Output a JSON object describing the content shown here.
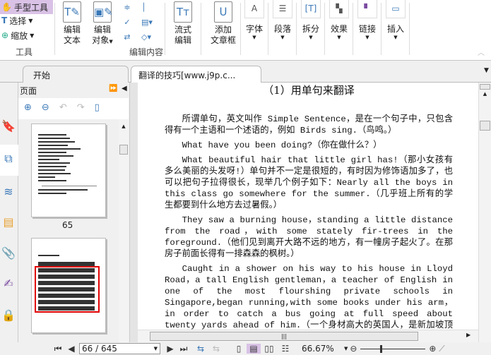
{
  "ribbon": {
    "tools": {
      "hand": "手型工具",
      "select": "选择",
      "zoom": "缩放",
      "group": "工具"
    },
    "edit": {
      "edit_text": [
        "编辑",
        "文本"
      ],
      "edit_object": [
        "编辑",
        "对象"
      ],
      "flow_edit": [
        "流式",
        "编辑"
      ],
      "add_frame": [
        "添加",
        "文章框"
      ],
      "group": "编辑内容"
    },
    "format": [
      "字体",
      "段落",
      "拆分",
      "效果",
      "链接",
      "插入"
    ]
  },
  "tabs": [
    {
      "label": "开始"
    },
    {
      "label": "翻译的技巧[www.j9p.c...",
      "close": "x"
    }
  ],
  "panel": {
    "title": "页面",
    "thumb_labels": [
      "65"
    ]
  },
  "document": {
    "title": "（1）用单句来翻译",
    "paragraphs": [
      "所谓单句，英文叫作 Simple Sentence，是在一个句子中，只包含得有一个主语和一个述语的，例如 Birds sing.（鸟鸣。）",
      "What have you been doing?（你在做什么？）",
      "What beautiful hair that little girl has!（那小女孩有多么美丽的头发呀!）单句并不一定是很短的，有时因为修饰语加多了，也可以把句子拉得很长，现举几个例子如下：Nearly all the boys in this class go somewhere for the summer.（几乎班上所有的学生都要到什么地方去过暑假。）",
      "They saw a burning house，standing a little distance from the road，with some stately fir-trees in the foreground.（他们见到离开大路不远的地方，有一幢房子起火了。在那房子前面长得有一排森森的枫树。）",
      "Caught in a shower on his way to his house in Lloyd Road，a tall English gentleman，a teacher of English in one of the most flourshing private schools in Singapore,began running,with some books under his arm，in order to catch a bus going at full speed about twenty yards ahead of him.（一个身材高大的英国人，是新加坡顶发达的一间私立学校的英文教员，"
    ]
  },
  "status": {
    "page": "66 / 645",
    "zoom": "66.67%"
  },
  "colors": {
    "accent": "#d9c2e6",
    "highlight": "#e00000"
  }
}
